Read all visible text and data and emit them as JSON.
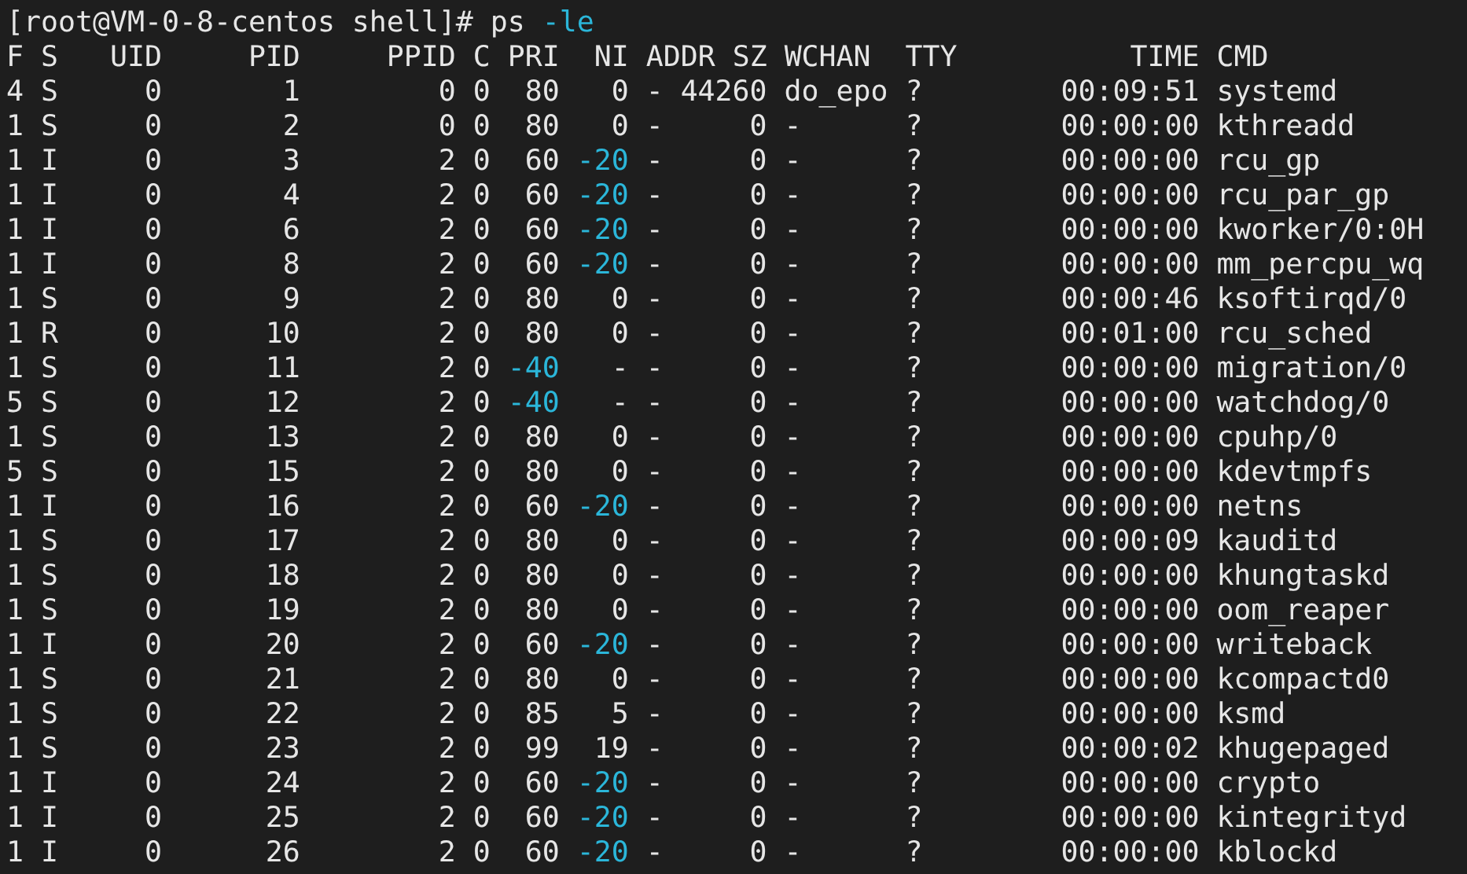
{
  "prompt": {
    "text": "[root@VM-0-8-centos shell]#",
    "command": "ps",
    "option": "-le"
  },
  "table": {
    "columns": [
      "F",
      "S",
      "UID",
      "PID",
      "PPID",
      "C",
      "PRI",
      "NI",
      "ADDR",
      "SZ",
      "WCHAN",
      "TTY",
      "TIME",
      "CMD"
    ],
    "rows": [
      {
        "cells": [
          "4",
          "S",
          "0",
          "1",
          "0",
          "0",
          "80",
          "0",
          "-",
          "44260",
          "do_epo",
          "?",
          "00:09:51",
          "systemd"
        ]
      },
      {
        "cells": [
          "1",
          "S",
          "0",
          "2",
          "0",
          "0",
          "80",
          "0",
          "-",
          "0",
          "-",
          "?",
          "00:00:00",
          "kthreadd"
        ]
      },
      {
        "cells": [
          "1",
          "I",
          "0",
          "3",
          "2",
          "0",
          "60",
          {
            "text": "-20",
            "highlighted": true
          },
          "-",
          "0",
          "-",
          "?",
          "00:00:00",
          "rcu_gp"
        ]
      },
      {
        "cells": [
          "1",
          "I",
          "0",
          "4",
          "2",
          "0",
          "60",
          {
            "text": "-20",
            "highlighted": true
          },
          "-",
          "0",
          "-",
          "?",
          "00:00:00",
          "rcu_par_gp"
        ]
      },
      {
        "cells": [
          "1",
          "I",
          "0",
          "6",
          "2",
          "0",
          "60",
          {
            "text": "-20",
            "highlighted": true
          },
          "-",
          "0",
          "-",
          "?",
          "00:00:00",
          "kworker/0:0H"
        ]
      },
      {
        "cells": [
          "1",
          "I",
          "0",
          "8",
          "2",
          "0",
          "60",
          {
            "text": "-20",
            "highlighted": true
          },
          "-",
          "0",
          "-",
          "?",
          "00:00:00",
          "mm_percpu_wq"
        ]
      },
      {
        "cells": [
          "1",
          "S",
          "0",
          "9",
          "2",
          "0",
          "80",
          "0",
          "-",
          "0",
          "-",
          "?",
          "00:00:46",
          "ksoftirqd/0"
        ]
      },
      {
        "cells": [
          "1",
          "R",
          "0",
          "10",
          "2",
          "0",
          "80",
          "0",
          "-",
          "0",
          "-",
          "?",
          "00:01:00",
          "rcu_sched"
        ]
      },
      {
        "cells": [
          "1",
          "S",
          "0",
          "11",
          "2",
          "0",
          {
            "text": "-40",
            "highlighted": true
          },
          "-",
          "-",
          "0",
          "-",
          "?",
          "00:00:00",
          "migration/0"
        ]
      },
      {
        "cells": [
          "5",
          "S",
          "0",
          "12",
          "2",
          "0",
          {
            "text": "-40",
            "highlighted": true
          },
          "-",
          "-",
          "0",
          "-",
          "?",
          "00:00:00",
          "watchdog/0"
        ]
      },
      {
        "cells": [
          "1",
          "S",
          "0",
          "13",
          "2",
          "0",
          "80",
          "0",
          "-",
          "0",
          "-",
          "?",
          "00:00:00",
          "cpuhp/0"
        ]
      },
      {
        "cells": [
          "5",
          "S",
          "0",
          "15",
          "2",
          "0",
          "80",
          "0",
          "-",
          "0",
          "-",
          "?",
          "00:00:00",
          "kdevtmpfs"
        ]
      },
      {
        "cells": [
          "1",
          "I",
          "0",
          "16",
          "2",
          "0",
          "60",
          {
            "text": "-20",
            "highlighted": true
          },
          "-",
          "0",
          "-",
          "?",
          "00:00:00",
          "netns"
        ]
      },
      {
        "cells": [
          "1",
          "S",
          "0",
          "17",
          "2",
          "0",
          "80",
          "0",
          "-",
          "0",
          "-",
          "?",
          "00:00:09",
          "kauditd"
        ]
      },
      {
        "cells": [
          "1",
          "S",
          "0",
          "18",
          "2",
          "0",
          "80",
          "0",
          "-",
          "0",
          "-",
          "?",
          "00:00:00",
          "khungtaskd"
        ]
      },
      {
        "cells": [
          "1",
          "S",
          "0",
          "19",
          "2",
          "0",
          "80",
          "0",
          "-",
          "0",
          "-",
          "?",
          "00:00:00",
          "oom_reaper"
        ]
      },
      {
        "cells": [
          "1",
          "I",
          "0",
          "20",
          "2",
          "0",
          "60",
          {
            "text": "-20",
            "highlighted": true
          },
          "-",
          "0",
          "-",
          "?",
          "00:00:00",
          "writeback"
        ]
      },
      {
        "cells": [
          "1",
          "S",
          "0",
          "21",
          "2",
          "0",
          "80",
          "0",
          "-",
          "0",
          "-",
          "?",
          "00:00:00",
          "kcompactd0"
        ]
      },
      {
        "cells": [
          "1",
          "S",
          "0",
          "22",
          "2",
          "0",
          "85",
          "5",
          "-",
          "0",
          "-",
          "?",
          "00:00:00",
          "ksmd"
        ]
      },
      {
        "cells": [
          "1",
          "S",
          "0",
          "23",
          "2",
          "0",
          "99",
          "19",
          "-",
          "0",
          "-",
          "?",
          "00:00:02",
          "khugepaged"
        ]
      },
      {
        "cells": [
          "1",
          "I",
          "0",
          "24",
          "2",
          "0",
          "60",
          {
            "text": "-20",
            "highlighted": true
          },
          "-",
          "0",
          "-",
          "?",
          "00:00:00",
          "crypto"
        ]
      },
      {
        "cells": [
          "1",
          "I",
          "0",
          "25",
          "2",
          "0",
          "60",
          {
            "text": "-20",
            "highlighted": true
          },
          "-",
          "0",
          "-",
          "?",
          "00:00:00",
          "kintegrityd"
        ]
      },
      {
        "cells": [
          "1",
          "I",
          "0",
          "26",
          "2",
          "0",
          "60",
          {
            "text": "-20",
            "highlighted": true
          },
          "-",
          "0",
          "-",
          "?",
          "00:00:00",
          "kblockd"
        ]
      }
    ]
  }
}
